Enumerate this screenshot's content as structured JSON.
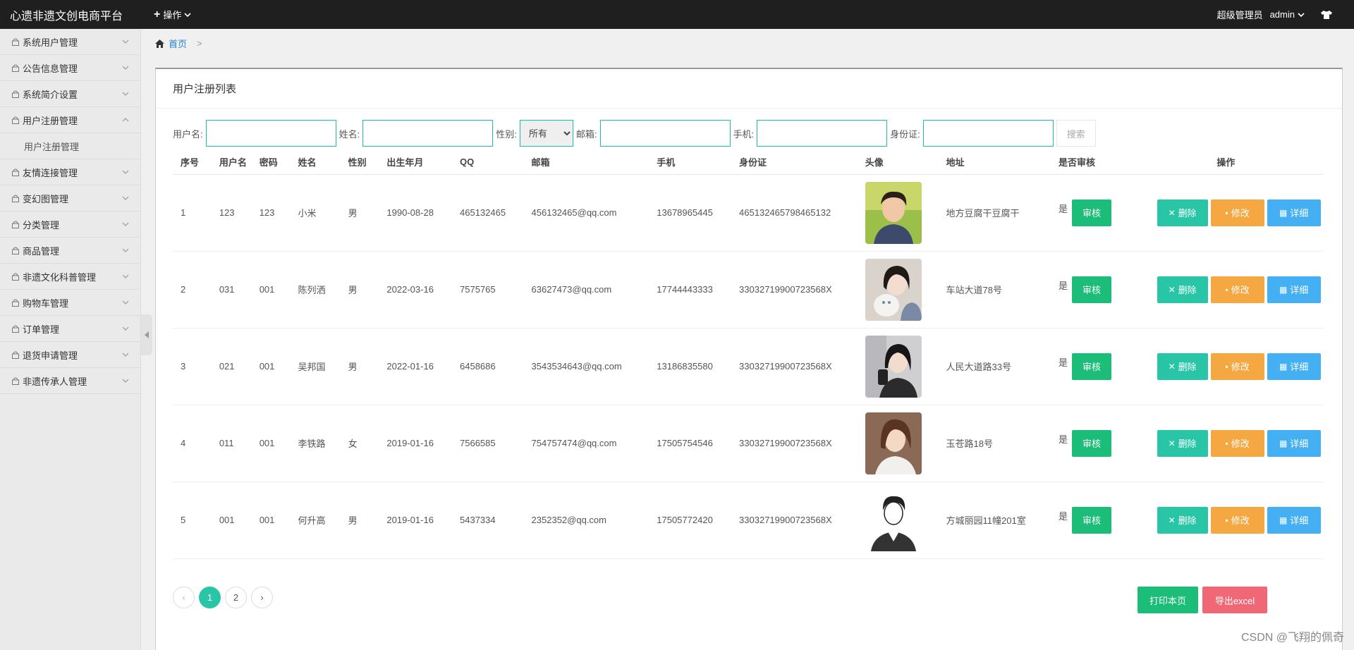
{
  "topbar": {
    "brand": "心遗非遗文创电商平台",
    "ops_label": "操作",
    "role": "超级管理员",
    "user": "admin"
  },
  "sidebar": {
    "items": [
      {
        "label": "系统用户管理",
        "expanded": false
      },
      {
        "label": "公告信息管理",
        "expanded": false
      },
      {
        "label": "系统简介设置",
        "expanded": false
      },
      {
        "label": "用户注册管理",
        "expanded": true,
        "sub": [
          "用户注册管理"
        ]
      },
      {
        "label": "友情连接管理",
        "expanded": false
      },
      {
        "label": "变幻图管理",
        "expanded": false
      },
      {
        "label": "分类管理",
        "expanded": false
      },
      {
        "label": "商品管理",
        "expanded": false
      },
      {
        "label": "非遗文化科普管理",
        "expanded": false
      },
      {
        "label": "购物车管理",
        "expanded": false
      },
      {
        "label": "订单管理",
        "expanded": false
      },
      {
        "label": "退货申请管理",
        "expanded": false
      },
      {
        "label": "非遗传承人管理",
        "expanded": false
      }
    ]
  },
  "breadcrumb": {
    "home": "首页",
    "sep": ">"
  },
  "card": {
    "title": "用户注册列表"
  },
  "filter": {
    "username_label": "用户名:",
    "name_label": "姓名:",
    "gender_label": "性别:",
    "gender_value": "所有",
    "email_label": "邮箱:",
    "phone_label": "手机:",
    "idcard_label": "身份证:",
    "search_label": "搜索"
  },
  "table": {
    "columns": [
      "序号",
      "用户名",
      "密码",
      "姓名",
      "性别",
      "出生年月",
      "QQ",
      "邮箱",
      "手机",
      "身份证",
      "头像",
      "地址",
      "是否审核",
      "操作"
    ],
    "rows": [
      {
        "no": "1",
        "username": "123",
        "password": "123",
        "name": "小米",
        "gender": "男",
        "birth": "1990-08-28",
        "qq": "465132465",
        "email": "456132465@qq.com",
        "phone": "13678965445",
        "idcard": "465132465798465132",
        "address": "地方豆腐干豆腐干",
        "audited": "是"
      },
      {
        "no": "2",
        "username": "031",
        "password": "001",
        "name": "陈列洒",
        "gender": "男",
        "birth": "2022-03-16",
        "qq": "7575765",
        "email": "63627473@qq.com",
        "phone": "17744443333",
        "idcard": "33032719900723568X",
        "address": "车站大道78号",
        "audited": "是"
      },
      {
        "no": "3",
        "username": "021",
        "password": "001",
        "name": "吴邦国",
        "gender": "男",
        "birth": "2022-01-16",
        "qq": "6458686",
        "email": "3543534643@qq.com",
        "phone": "13186835580",
        "idcard": "33032719900723568X",
        "address": "人民大道路33号",
        "audited": "是"
      },
      {
        "no": "4",
        "username": "011",
        "password": "001",
        "name": "李铁路",
        "gender": "女",
        "birth": "2019-01-16",
        "qq": "7566585",
        "email": "754757474@qq.com",
        "phone": "17505754546",
        "idcard": "33032719900723568X",
        "address": "玉苍路18号",
        "audited": "是"
      },
      {
        "no": "5",
        "username": "001",
        "password": "001",
        "name": "何升高",
        "gender": "男",
        "birth": "2019-01-16",
        "qq": "5437334",
        "email": "2352352@qq.com",
        "phone": "17505772420",
        "idcard": "33032719900723568X",
        "address": "方城丽园11幢201室",
        "audited": "是"
      }
    ],
    "audit_label": "审核",
    "delete_label": "删除",
    "edit_label": "修改",
    "detail_label": "详细"
  },
  "pager": {
    "prev": "‹",
    "pages": [
      "1",
      "2"
    ],
    "next": "›",
    "current": "1"
  },
  "buttons": {
    "print": "打印本页",
    "export": "导出excel"
  },
  "watermark": "CSDN @飞翔的佩奇",
  "colors": {
    "accent": "#29c5a7",
    "green": "#1cbc79",
    "orange": "#f5a841",
    "blue": "#44b0f3",
    "red": "#f06876"
  }
}
